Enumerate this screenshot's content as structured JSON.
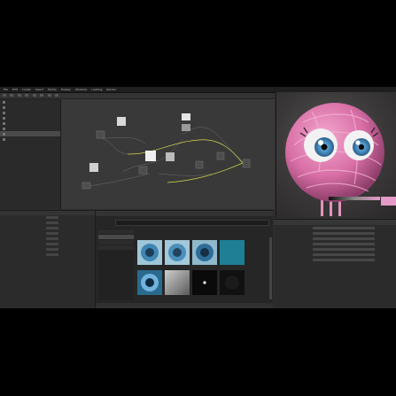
{
  "menubar": {
    "items": [
      "File",
      "Edit",
      "Create",
      "Select",
      "Modify",
      "Display",
      "Windows",
      "Lighting",
      "Render"
    ]
  },
  "colors": {
    "accent": "#e59ac8",
    "panel": "#2d2d2d",
    "graph": "#393939",
    "wire_selected": "#cfd64a"
  },
  "outliner": {
    "rows": 6,
    "selected_row": 5
  },
  "texture_browser": {
    "thumbnails": [
      "iris-blue-1",
      "iris-blue-2",
      "iris-blue-3",
      "teal-solid",
      "iris-blue-4",
      "gradient-gray",
      "white-dot",
      "dark-noise"
    ]
  },
  "viewport": {
    "subject": "pink-yarn-creature-icon"
  }
}
